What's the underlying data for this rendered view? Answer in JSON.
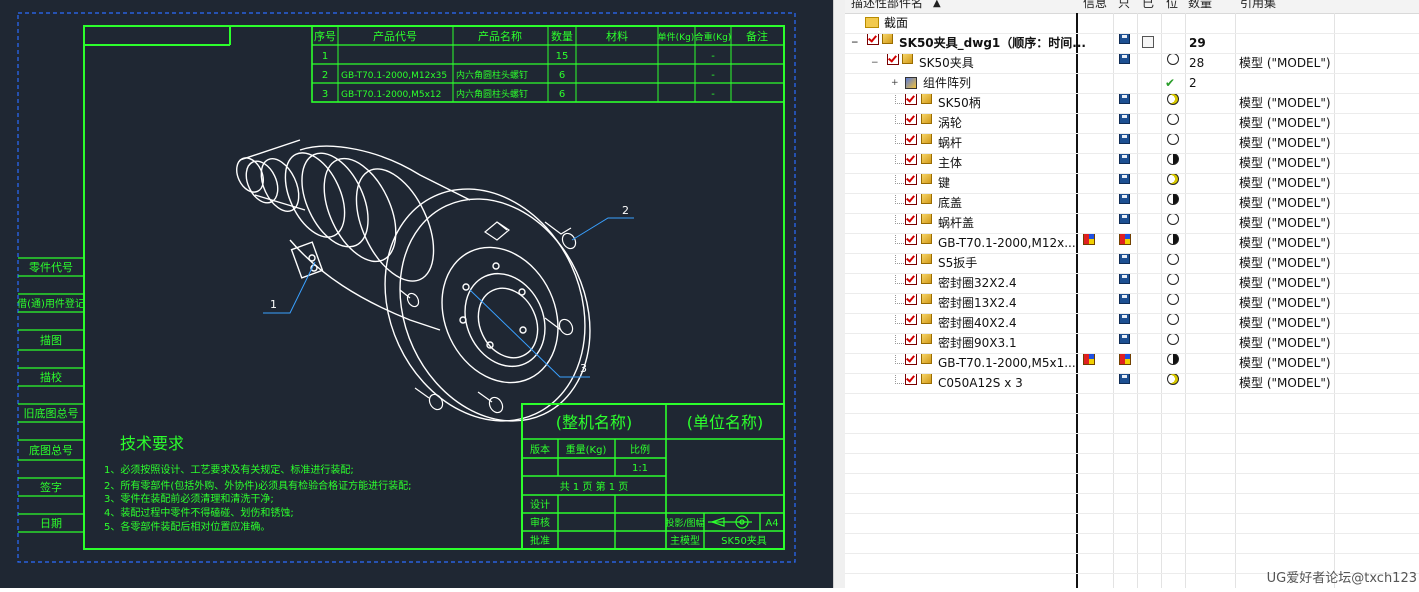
{
  "drawing": {
    "bom_headers": [
      "序号",
      "产品代号",
      "产品名称",
      "数量",
      "材料",
      "单件(Kg)",
      "合重(Kg)",
      "备注"
    ],
    "bom_rows": [
      [
        "1",
        "",
        "",
        "15",
        "",
        "",
        "-",
        ""
      ],
      [
        "2",
        "GB-T70.1-2000,M12x35",
        "内六角圆柱头螺钉",
        "6",
        "",
        "",
        "-",
        ""
      ],
      [
        "3",
        "GB-T70.1-2000,M5x12",
        "内六角圆柱头螺钉",
        "6",
        "",
        "",
        "-",
        ""
      ]
    ],
    "side_labels": [
      "零件代号",
      "借(通)用件登记",
      "描图",
      "描校",
      "旧底图总号",
      "底图总号",
      "签字",
      "日期"
    ],
    "balloons": [
      "1",
      "2",
      "3"
    ],
    "tech_title": "技术要求",
    "tech_lines": [
      "1、必须按照设计、工艺要求及有关规定、标准进行装配;",
      "2、所有零部件(包括外购、外协件)必须具有检验合格证方能进行装配;",
      "3、零件在装配前必须清理和清洗干净;",
      "4、装配过程中零件不得磕碰、划伤和锈蚀;",
      "5、各零部件装配后相对位置应准确。"
    ],
    "title_block": {
      "machine_name": "(整机名称)",
      "unit_name": "(单位名称)",
      "version": "版本",
      "weight": "重量(Kg)",
      "scale_label": "比例",
      "scale_value": "1:1",
      "sheet_info": "共 1 页   第 1 页",
      "design": "设计",
      "review": "审核",
      "approve": "批准",
      "projection": "投影/图幅",
      "paper_size": "A4",
      "master_model": "主模型",
      "model_name": "SK50夹具"
    }
  },
  "navigator": {
    "columns": [
      "描述性部件名",
      "信息",
      "只",
      "已",
      "位",
      "数量",
      "引用集"
    ],
    "section_label": "截面",
    "root": {
      "name": "SK50夹具_dwg1（顺序：时间...",
      "qty": "29"
    },
    "assembly": {
      "name": "SK50夹具",
      "qty": "28",
      "ref": "模型 (\"MODEL\")"
    },
    "array": {
      "name": "组件阵列",
      "qty": "2"
    },
    "parts": [
      {
        "name": "SK50柄",
        "info": false,
        "pos": "moon",
        "ref": "模型 (\"MODEL\")"
      },
      {
        "name": "涡轮",
        "info": false,
        "pos": "open",
        "ref": "模型 (\"MODEL\")"
      },
      {
        "name": "蜗杆",
        "info": false,
        "pos": "open",
        "ref": "模型 (\"MODEL\")"
      },
      {
        "name": "主体",
        "info": false,
        "pos": "half",
        "ref": "模型 (\"MODEL\")"
      },
      {
        "name": "键",
        "info": false,
        "pos": "moon",
        "ref": "模型 (\"MODEL\")"
      },
      {
        "name": "底盖",
        "info": false,
        "pos": "half",
        "ref": "模型 (\"MODEL\")"
      },
      {
        "name": "蜗杆盖",
        "info": false,
        "pos": "open",
        "ref": "模型 (\"MODEL\")"
      },
      {
        "name": "GB-T70.1-2000,M12x...",
        "info": true,
        "pos": "half",
        "ref": "模型 (\"MODEL\")"
      },
      {
        "name": "S5扳手",
        "info": false,
        "pos": "open",
        "ref": "模型 (\"MODEL\")"
      },
      {
        "name": "密封圈32X2.4",
        "info": false,
        "pos": "open",
        "ref": "模型 (\"MODEL\")"
      },
      {
        "name": "密封圈13X2.4",
        "info": false,
        "pos": "open",
        "ref": "模型 (\"MODEL\")"
      },
      {
        "name": "密封圈40X2.4",
        "info": false,
        "pos": "open",
        "ref": "模型 (\"MODEL\")"
      },
      {
        "name": "密封圈90X3.1",
        "info": false,
        "pos": "open",
        "ref": "模型 (\"MODEL\")"
      },
      {
        "name": "GB-T70.1-2000,M5x1...",
        "info": true,
        "pos": "half",
        "ref": "模型 (\"MODEL\")"
      },
      {
        "name": "C050A12S x 3",
        "info": false,
        "pos": "moon",
        "ref": "模型 (\"MODEL\")"
      }
    ]
  },
  "watermark": "UG爱好者论坛@txch123"
}
